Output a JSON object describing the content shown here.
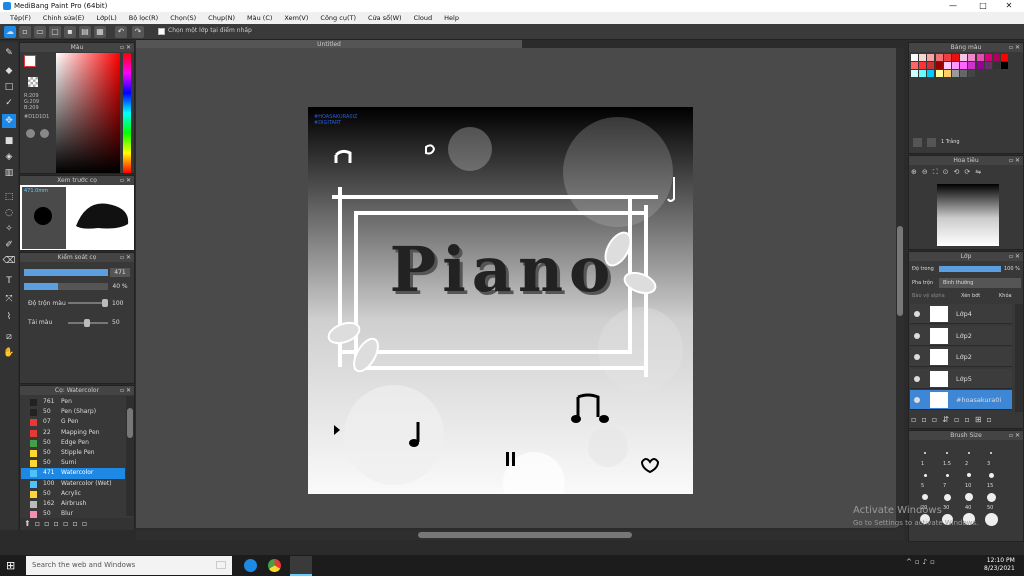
{
  "window": {
    "title": "MediBang Paint Pro (64bit)",
    "min": "—",
    "max": "□",
    "close": "✕"
  },
  "menu": [
    "Tệp(F)",
    "Chỉnh sửa(E)",
    "Lớp(L)",
    "Bộ lọc(R)",
    "Chọn(S)",
    "Chụp(N)",
    "Màu (C)",
    "Xem(V)",
    "Công cụ(T)",
    "Cửa sổ(W)",
    "Cloud",
    "Help"
  ],
  "toolbar": {
    "checkbox_label": "Chọn một lớp tại điểm nhấp",
    "undo": "↶",
    "redo": "↷"
  },
  "color_panel": {
    "title": "Màu",
    "r": "R:209",
    "g": "G:209",
    "b": "B:209",
    "hex": "#D1D1D1"
  },
  "brush_preview": {
    "title": "Xem trước cọ",
    "size": "471.0mm"
  },
  "brush_control": {
    "title": "Kiểm soát cọ",
    "size_value": "471",
    "opacity_value": "40 %",
    "mix_label": "Độ trộn màu",
    "mix_value": "100",
    "paint_label": "Tải màu",
    "paint_value": "50"
  },
  "brush_list": {
    "title": "Cọ: Watercolor",
    "items": [
      {
        "size": "761",
        "name": "Pen",
        "color": "#222222"
      },
      {
        "size": "50",
        "name": "Pen (Sharp)",
        "color": "#222222"
      },
      {
        "size": "07",
        "name": "G Pen",
        "color": "#e53935"
      },
      {
        "size": "22",
        "name": "Mapping Pen",
        "color": "#e53935"
      },
      {
        "size": "50",
        "name": "Edge Pen",
        "color": "#43a047"
      },
      {
        "size": "50",
        "name": "Stipple Pen",
        "color": "#fdd835"
      },
      {
        "size": "50",
        "name": "Sumi",
        "color": "#fdd835"
      },
      {
        "size": "471",
        "name": "Watercolor",
        "color": "#4fc3f7"
      },
      {
        "size": "100",
        "name": "Watercolor (Wet)",
        "color": "#4fc3f7"
      },
      {
        "size": "50",
        "name": "Acrylic",
        "color": "#fdd835"
      },
      {
        "size": "162",
        "name": "Airbrush",
        "color": "#bbbbbb"
      },
      {
        "size": "50",
        "name": "Blur",
        "color": "#f48fb1"
      }
    ]
  },
  "document": {
    "title": "Untitled"
  },
  "artwork": {
    "watermark_line1": "#HOASAKURA0IZ",
    "watermark_line2": "#DIGITART",
    "text": "Piano"
  },
  "color_set": {
    "title": "Bảng màu",
    "set_name": "1 Trắng"
  },
  "navigator": {
    "title": "Hoa tiêu"
  },
  "layers": {
    "title": "Lớp",
    "opacity_label": "Độ trong",
    "opacity_value": "100 %",
    "blend_label": "Pha trộn",
    "blend_value": "Bình thường",
    "protect_alpha": "Bảo vệ alpha",
    "clipping": "Xén bớt",
    "lock": "Khóa",
    "items": [
      {
        "name": "Lớp4",
        "selected": false
      },
      {
        "name": "Lớp2",
        "selected": false
      },
      {
        "name": "Lớp2",
        "selected": false
      },
      {
        "name": "Lớp5",
        "selected": false
      },
      {
        "name": "#hoasakura0i",
        "selected": true
      }
    ]
  },
  "brush_size": {
    "title": "Brush Size",
    "labels": [
      "1",
      "1.5",
      "2",
      "3",
      "5",
      "7",
      "10",
      "15",
      "20",
      "30",
      "40",
      "50"
    ]
  },
  "watermark": {
    "line1": "Activate Windows",
    "line2": "Go to Settings to activate Windows."
  },
  "taskbar": {
    "search": "Search the web and Windows",
    "time": "12:10 PM",
    "date": "8/23/2021"
  },
  "colors": {
    "accent": "#1e88e5",
    "panel": "#383838",
    "canvas_bg": "#4a4a4a"
  }
}
